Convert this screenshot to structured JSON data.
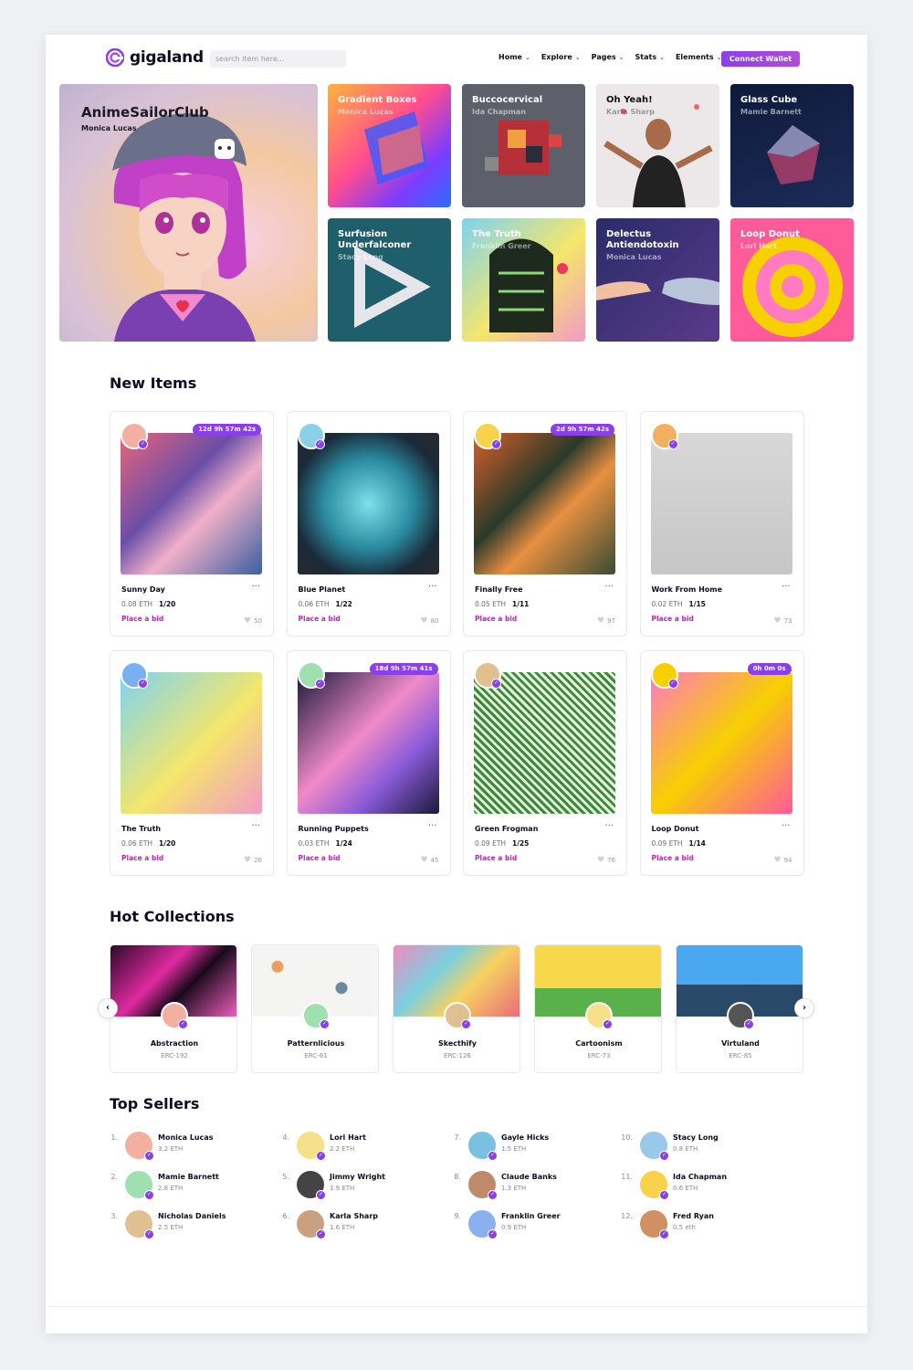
{
  "brand": {
    "name": "gigaland",
    "accent": "#8a3fe8"
  },
  "search": {
    "placeholder": "search item here..."
  },
  "nav": [
    "Home",
    "Explore",
    "Pages",
    "Stats",
    "Elements"
  ],
  "wallet_button": "Connect Wallet",
  "hero": {
    "main": {
      "title": "AnimeSailorClub",
      "artist": "Monica Lucas"
    },
    "tiles": [
      {
        "title": "Gradient Boxes",
        "artist": "Monica Lucas"
      },
      {
        "title": "Buccocervical",
        "artist": "Ida Chapman"
      },
      {
        "title": "Oh Yeah!",
        "artist": "Karla Sharp"
      },
      {
        "title": "Glass Cube",
        "artist": "Mamie Barnett"
      },
      {
        "title": "Surfusion Underfalconer",
        "artist": "Stacy Long"
      },
      {
        "title": "The Truth",
        "artist": "Franklin Greer"
      },
      {
        "title": "Delectus Antiendotoxin",
        "artist": "Monica Lucas"
      },
      {
        "title": "Loop Donut",
        "artist": "Lori Hart"
      }
    ]
  },
  "new_items": {
    "title": "New Items",
    "place_bid_label": "Place a bid",
    "items": [
      {
        "name": "Sunny Day",
        "price": "0.08 ETH",
        "qty": "1/20",
        "likes": "50",
        "timer": "12d  9h  57m  42s"
      },
      {
        "name": "Blue Planet",
        "price": "0.06 ETH",
        "qty": "1/22",
        "likes": "80",
        "timer": ""
      },
      {
        "name": "Finally Free",
        "price": "0.05 ETH",
        "qty": "1/11",
        "likes": "97",
        "timer": "2d  9h  57m  42s"
      },
      {
        "name": "Work From Home",
        "price": "0.02 ETH",
        "qty": "1/15",
        "likes": "73",
        "timer": ""
      },
      {
        "name": "The Truth",
        "price": "0.06 ETH",
        "qty": "1/20",
        "likes": "26",
        "timer": ""
      },
      {
        "name": "Running Puppets",
        "price": "0.03 ETH",
        "qty": "1/24",
        "likes": "45",
        "timer": "18d  9h  57m  41s"
      },
      {
        "name": "Green Frogman",
        "price": "0.09 ETH",
        "qty": "1/25",
        "likes": "76",
        "timer": ""
      },
      {
        "name": "Loop Donut",
        "price": "0.09 ETH",
        "qty": "1/14",
        "likes": "94",
        "timer": "0h  0m  0s"
      }
    ]
  },
  "hot_collections": {
    "title": "Hot Collections",
    "items": [
      {
        "name": "Abstraction",
        "type": "ERC-192"
      },
      {
        "name": "Patternlicious",
        "type": "ERC-61"
      },
      {
        "name": "Skecthify",
        "type": "ERC-126"
      },
      {
        "name": "Cartoonism",
        "type": "ERC-73"
      },
      {
        "name": "Virtuland",
        "type": "ERC-85"
      }
    ]
  },
  "top_sellers": {
    "title": "Top Sellers",
    "items": [
      {
        "rank": "1.",
        "name": "Monica Lucas",
        "eth": "3.2 ETH"
      },
      {
        "rank": "2.",
        "name": "Mamie Barnett",
        "eth": "2.8 ETH"
      },
      {
        "rank": "3.",
        "name": "Nicholas Daniels",
        "eth": "2.5 ETH"
      },
      {
        "rank": "4.",
        "name": "Lori Hart",
        "eth": "2.2 ETH"
      },
      {
        "rank": "5.",
        "name": "Jimmy Wright",
        "eth": "1.9 ETH"
      },
      {
        "rank": "6.",
        "name": "Karla Sharp",
        "eth": "1.6 ETH"
      },
      {
        "rank": "7.",
        "name": "Gayle Hicks",
        "eth": "1.5 ETH"
      },
      {
        "rank": "8.",
        "name": "Claude Banks",
        "eth": "1.3 ETH"
      },
      {
        "rank": "9.",
        "name": "Franklin Greer",
        "eth": "0.9 ETH"
      },
      {
        "rank": "10.",
        "name": "Stacy Long",
        "eth": "0.8 ETH"
      },
      {
        "rank": "11.",
        "name": "Ida Chapman",
        "eth": "0.6 ETH"
      },
      {
        "rank": "12.",
        "name": "Fred Ryan",
        "eth": "0.5 eth"
      }
    ]
  }
}
